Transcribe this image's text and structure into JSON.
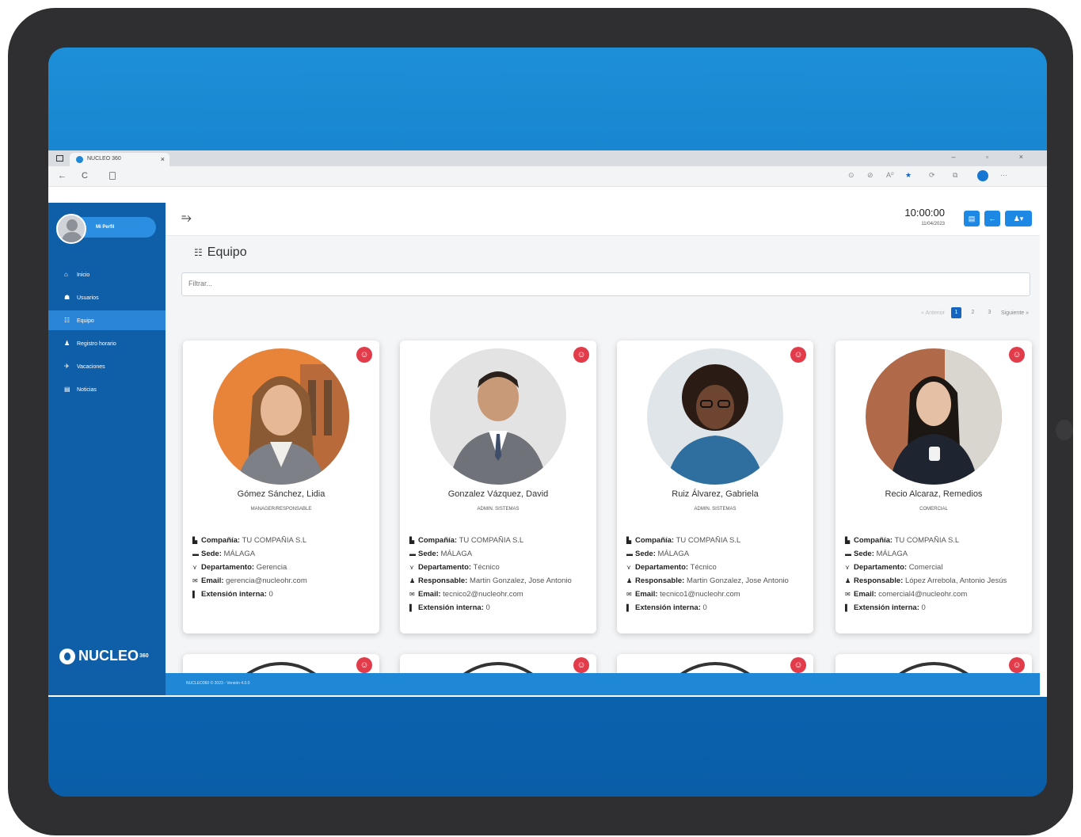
{
  "browser": {
    "tab_title": "NUCLEO 360",
    "tab_close": "×",
    "back": "←",
    "reload": "C",
    "window_controls": "–  ▫  ×",
    "toolbar_icons": [
      "⊙",
      "⊘",
      "A⁰",
      "★",
      "⟳",
      "⧉",
      "⋯"
    ]
  },
  "sidebar": {
    "profile_label": "Mi Perfil",
    "items": [
      {
        "label": "Inicio",
        "icon": "home-icon",
        "glyph": "⌂"
      },
      {
        "label": "Usuarios",
        "icon": "users-icon",
        "glyph": "☗"
      },
      {
        "label": "Equipo",
        "icon": "team-icon",
        "glyph": "☷",
        "active": true
      },
      {
        "label": "Registro horario",
        "icon": "clock-user-icon",
        "glyph": "♟"
      },
      {
        "label": "Vacaciones",
        "icon": "vacation-icon",
        "glyph": "✈"
      },
      {
        "label": "Noticias",
        "icon": "news-icon",
        "glyph": "▤"
      }
    ],
    "brand": "NUCLEO",
    "brand_sup": "360"
  },
  "topbar": {
    "time": "10:00:00",
    "date": "11/04/2023",
    "btn1": "▤",
    "btn2": "←",
    "btn3": "♟▾"
  },
  "main": {
    "title": "Equipo",
    "filter_placeholder": "Filtrar...",
    "pager": {
      "prev": "« Anterior",
      "pages": [
        "1",
        "2",
        "3"
      ],
      "next": "Siguiente »"
    }
  },
  "labels": {
    "company": "Compañía:",
    "site": "Sede:",
    "department": "Departamento:",
    "responsible": "Responsable:",
    "email": "Email:",
    "extension": "Extensión interna:"
  },
  "cards": [
    {
      "name": "Gómez Sánchez, Lidia",
      "role": "MANAGER/RESPONSABLE",
      "company": "TU COMPAÑIA S.L",
      "site": "MÁLAGA",
      "department": "Gerencia",
      "responsible": "",
      "email": "gerencia@nucleohr.com",
      "extension": "0"
    },
    {
      "name": "Gonzalez Vázquez, David",
      "role": "ADMIN. SISTEMAS",
      "company": "TU COMPAÑIA S.L",
      "site": "MÁLAGA",
      "department": "Técnico",
      "responsible": "Martin Gonzalez, Jose Antonio",
      "email": "tecnico2@nucleohr.com",
      "extension": "0"
    },
    {
      "name": "Ruiz Álvarez, Gabriela",
      "role": "ADMIN. SISTEMAS",
      "company": "TU COMPAÑIA S.L",
      "site": "MÁLAGA",
      "department": "Técnico",
      "responsible": "Martin Gonzalez, Jose Antonio",
      "email": "tecnico1@nucleohr.com",
      "extension": "0"
    },
    {
      "name": "Recio Alcaraz, Remedios",
      "role": "COMERCIAL",
      "company": "TU COMPAÑIA S.L",
      "site": "MÁLAGA",
      "department": "Comercial",
      "responsible": "López Arrebola, Antonio Jesús",
      "email": "comercial4@nucleohr.com",
      "extension": "0"
    }
  ],
  "footer": "NUCLEO360 © 2023 - Versión 4.0.0",
  "colors": {
    "sidebar": "#0f5fa8",
    "accent": "#1e88e5",
    "badge": "#e23b4a"
  }
}
